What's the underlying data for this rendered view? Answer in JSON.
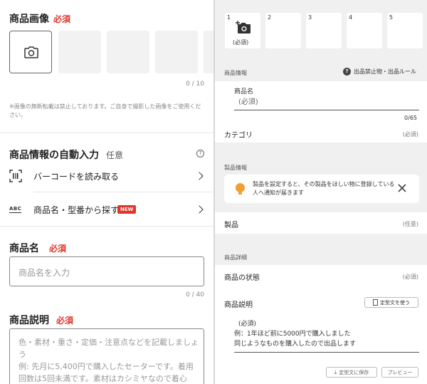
{
  "left": {
    "images": {
      "title": "商品画像",
      "required": "必須",
      "count": "0 / 10",
      "notice": "※画像の無断転載は禁止しております。ご自身で撮影した画像をご使用ください。"
    },
    "auto_input": {
      "title": "商品情報の自動入力",
      "optional": "任意",
      "barcode_icon": "barcode-icon",
      "barcode_label": "バーコードを読み取る",
      "abc_icon_text": "ABC",
      "model_label": "商品名・型番から探す",
      "new_badge": "NEW"
    },
    "name": {
      "title": "商品名",
      "required": "必須",
      "placeholder": "商品名を入力",
      "count": "0 / 40"
    },
    "description": {
      "title": "商品説明",
      "required": "必須",
      "placeholder_lines": [
        "色・素材・重さ・定価・注意点などを記載しましょう",
        "例: 先月に5,400円で購入したセーターです。着用",
        "回数は5回未満です。素材はカシミヤなので着心"
      ]
    }
  },
  "right": {
    "slots": [
      "1",
      "2",
      "3",
      "4",
      "5"
    ],
    "first_slot_caption": "(必須)",
    "product_info_header": "商品情報",
    "rules_link": "出品禁止物・出品ルール",
    "name_label": "商品名",
    "name_placeholder": "(必須)",
    "name_count": "0/65",
    "category_label": "カテゴリ",
    "category_required": "(必須)",
    "seihin_header": "製品情報",
    "notice_text": "製品を設定すると、その製品をほしい物に登録している人へ通知が届きます",
    "seihin_label": "製品",
    "seihin_optional": "(任意)",
    "detail_header": "商品詳細",
    "condition_label": "商品の状態",
    "condition_required": "(必須)",
    "desc_label": "商品説明",
    "template_button": "定型文を使う",
    "desc_lines": [
      "(必須)",
      "例：1年ほど前に5000円で購入しました",
      "同じようなものを購入したので出品します"
    ],
    "save_template_button": "定型文に保存",
    "preview_button": "プレビュー"
  },
  "colors": {
    "accent": "#e0342c",
    "notice_bulb": "#f0a030"
  }
}
